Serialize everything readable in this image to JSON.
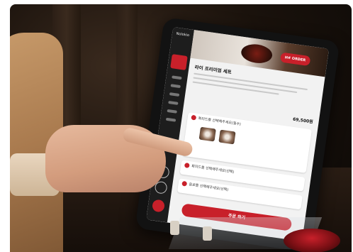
{
  "scene": {
    "description_tags": [
      "photo",
      "tablet-ordering-menu",
      "pointing-hand"
    ],
    "colors": {
      "accent": "#c8202a",
      "screen_bg": "#f2f2f2",
      "sidebar": "#1d1d1d"
    }
  },
  "tablet": {
    "brand": "Nolokio",
    "badge": "H# ORDER",
    "menu_title": "라이 프리미엄 세트",
    "price": "69,500원",
    "options": [
      {
        "label": "회미드를 선택해주세요(필수)"
      },
      {
        "label": "회미드를 선택해주세요(선택)"
      },
      {
        "label": "음료를 선택해주세요(선택)"
      }
    ],
    "order_button": "주문 하기"
  }
}
